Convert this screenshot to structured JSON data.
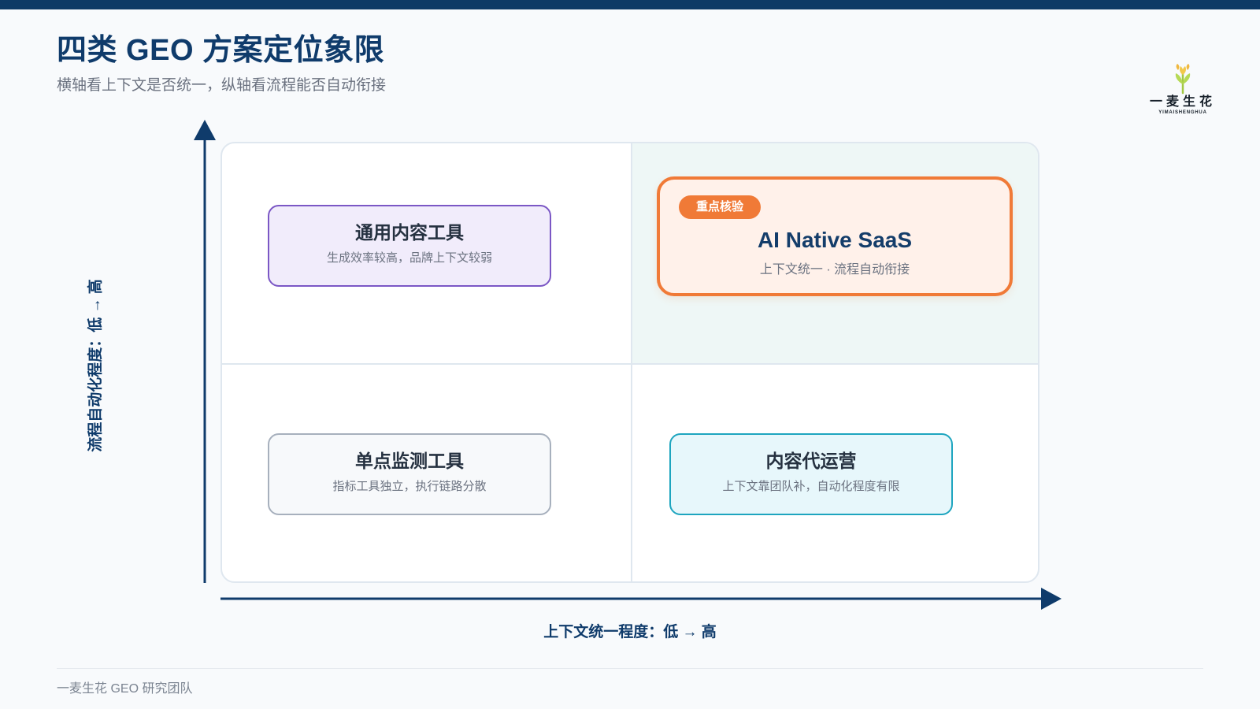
{
  "header": {
    "title": "四类 GEO 方案定位象限",
    "subtitle": "横轴看上下文是否统一，纵轴看流程能否自动衔接"
  },
  "brand": {
    "logo_text": "一麦生花",
    "logo_subtext": "YIMAISHENGHUA",
    "logo_icon": "wheat-flower-icon"
  },
  "axes": {
    "y_label": "流程自动化程度：低 → 高",
    "x_label": "上下文统一程度：低 → 高"
  },
  "quadrants": [
    {
      "id": "general-content-tools",
      "title": "通用内容工具",
      "description": "生成效率较高，品牌上下文较弱"
    },
    {
      "id": "ai-native-saas",
      "badge": "重点核验",
      "title": "AI Native SaaS",
      "description": "上下文统一 · 流程自动衔接"
    },
    {
      "id": "single-point-monitoring-tools",
      "title": "单点监测工具",
      "description": "指标工具独立，执行链路分散"
    },
    {
      "id": "content-agency-operations",
      "title": "内容代运营",
      "description": "上下文靠团队补，自动化程度有限"
    }
  ],
  "footer": {
    "text": "一麦生花 GEO 研究团队"
  },
  "colors": {
    "navy": "#0f3b6b",
    "orange": "#f07a37",
    "purple": "#7b57c5",
    "cyan": "#1ea5bf",
    "gray": "#a7b0bd",
    "mint_highlight": "#eef7f6"
  }
}
